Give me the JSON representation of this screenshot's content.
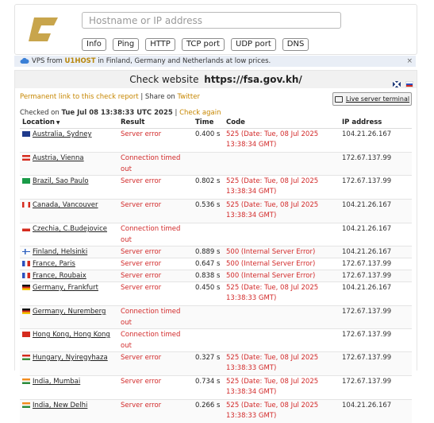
{
  "search": {
    "placeholder": "Hostname or IP address",
    "tools": [
      "Info",
      "Ping",
      "HTTP",
      "TCP port",
      "UDP port",
      "DNS"
    ]
  },
  "ad": {
    "prefix": "VPS from ",
    "brand": "U1HOST",
    "suffix": " in Finland, Germany and Netherlands at low prices.",
    "close": "×"
  },
  "header": {
    "check_label": "Check website",
    "url": "https://fsa.gov.kh/"
  },
  "links": {
    "permanent": "Permanent link to this check report",
    "separator": " | Share on ",
    "twitter": "Twitter",
    "live_terminal": "Live server terminal"
  },
  "checked": {
    "prefix": "Checked on ",
    "timestamp": "Tue Jul 08 13:38:33 UTC 2025",
    "separator": " | ",
    "again": "Check again"
  },
  "table": {
    "headers": {
      "location": "Location",
      "sort_indicator": "▼",
      "result": "Result",
      "time": "Time",
      "code": "Code",
      "ip": "IP address"
    },
    "rows": [
      {
        "location": "Australia, Sydney",
        "flag": "au",
        "result": "Server error",
        "time": "0.400 s",
        "code": "525 (Date: Tue, 08 Jul 2025 13:38:34 GMT)",
        "ip": "104.21.26.167"
      },
      {
        "location": "Austria, Vienna",
        "flag": "at",
        "result": "Connection timed out",
        "time": "",
        "code": "",
        "ip": "172.67.137.99"
      },
      {
        "location": "Brazil, Sao Paulo",
        "flag": "br",
        "result": "Server error",
        "time": "0.802 s",
        "code": "525 (Date: Tue, 08 Jul 2025 13:38:34 GMT)",
        "ip": "172.67.137.99"
      },
      {
        "location": "Canada, Vancouver",
        "flag": "ca",
        "result": "Server error",
        "time": "0.536 s",
        "code": "525 (Date: Tue, 08 Jul 2025 13:38:34 GMT)",
        "ip": "104.21.26.167"
      },
      {
        "location": "Czechia, C.Budejovice",
        "flag": "cz",
        "result": "Connection timed out",
        "time": "",
        "code": "",
        "ip": "104.21.26.167"
      },
      {
        "location": "Finland, Helsinki",
        "flag": "fi",
        "result": "Server error",
        "time": "0.889 s",
        "code": "500 (Internal Server Error)",
        "ip": "104.21.26.167"
      },
      {
        "location": "France, Paris",
        "flag": "fr",
        "result": "Server error",
        "time": "0.647 s",
        "code": "500 (Internal Server Error)",
        "ip": "172.67.137.99"
      },
      {
        "location": "France, Roubaix",
        "flag": "fr",
        "result": "Server error",
        "time": "0.838 s",
        "code": "500 (Internal Server Error)",
        "ip": "172.67.137.99"
      },
      {
        "location": "Germany, Frankfurt",
        "flag": "de",
        "result": "Server error",
        "time": "0.450 s",
        "code": "525 (Date: Tue, 08 Jul 2025 13:38:33 GMT)",
        "ip": "104.21.26.167"
      },
      {
        "location": "Germany, Nuremberg",
        "flag": "de",
        "result": "Connection timed out",
        "time": "",
        "code": "",
        "ip": "172.67.137.99"
      },
      {
        "location": "Hong Kong, Hong Kong",
        "flag": "hk",
        "result": "Connection timed out",
        "time": "",
        "code": "",
        "ip": "172.67.137.99"
      },
      {
        "location": "Hungary, Nyiregyhaza",
        "flag": "hu",
        "result": "Server error",
        "time": "0.327 s",
        "code": "525 (Date: Tue, 08 Jul 2025 13:38:33 GMT)",
        "ip": "172.67.137.99"
      },
      {
        "location": "India, Mumbai",
        "flag": "in",
        "result": "Server error",
        "time": "0.734 s",
        "code": "525 (Date: Tue, 08 Jul 2025 13:38:34 GMT)",
        "ip": "172.67.137.99"
      },
      {
        "location": "India, New Delhi",
        "flag": "in",
        "result": "Server error",
        "time": "0.266 s",
        "code": "525 (Date: Tue, 08 Jul 2025 13:38:33 GMT)",
        "ip": "104.21.26.167"
      }
    ]
  },
  "colors": {
    "accent": "#c68600",
    "error": "#d22a2a",
    "logo": "#c8a54c"
  }
}
